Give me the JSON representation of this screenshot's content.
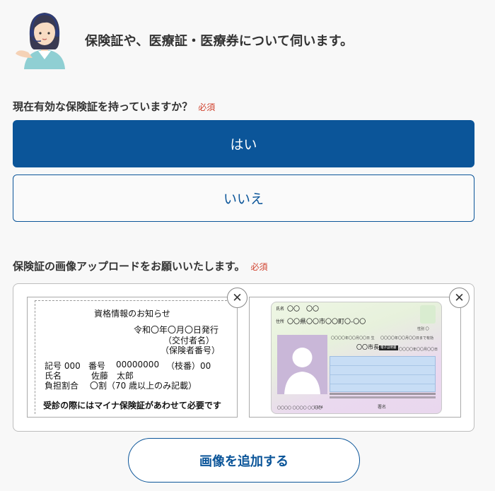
{
  "header": {
    "intro_text": "保険証や、医療証・医療券について伺います。"
  },
  "question1": {
    "label": "現在有効な保険証を持っていますか？",
    "required": "必須",
    "options": [
      "はい",
      "いいえ"
    ],
    "selected": "はい"
  },
  "question2": {
    "label": "保険証の画像アップロードをお願いいたします。",
    "required": "必須"
  },
  "card1": {
    "title": "資格情報のお知らせ",
    "issue_line": "令和〇年〇月〇日発行",
    "issuer_line": "（交付者名）",
    "insurer_line": "（保険者番号）",
    "number_label": "記号 000",
    "bango_label": "番号",
    "bango_value": "00000000",
    "branch": "（枝番）00",
    "name_label": "氏名",
    "name_value": "佐藤　太郎",
    "ratio_label": "負担割合",
    "ratio_value": "〇割（70 歳以上のみ記載）",
    "footer": "受診の際にはマイナ保険証があわせて必要です"
  },
  "card2": {
    "name_label": "氏名",
    "name_value": "〇〇　〇〇",
    "address_label": "住所",
    "address_value": "〇〇県〇〇市〇〇町〇-〇〇",
    "sex": "性別 〇",
    "dob": "〇〇〇〇年〇〇月〇〇日 生",
    "expiry": "〇〇〇〇年〇〇月〇〇日まで有効",
    "city": "〇〇市長",
    "badge": "電子証明書",
    "expiry2": "〇〇〇〇年〇〇月〇〇日",
    "serial": "1234",
    "sign_label": "署名",
    "small_left": "〇〇〇〇 〇〇〇〇 〇〇〇〇"
  },
  "add_button": {
    "label": "画像を追加する"
  },
  "colors": {
    "primary": "#0b5599",
    "required": "#d0402c",
    "background": "#f8f8f8"
  },
  "icons": {
    "close": "✕"
  }
}
